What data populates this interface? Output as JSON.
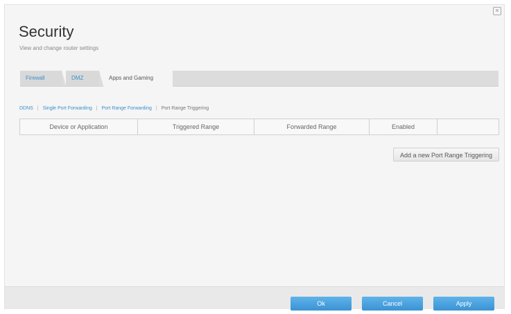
{
  "header": {
    "title": "Security",
    "subtitle": "View and change router settings"
  },
  "tabs": [
    {
      "label": "Firewall",
      "active": false
    },
    {
      "label": "DMZ",
      "active": false
    },
    {
      "label": "Apps and Gaming",
      "active": true
    }
  ],
  "subnav": {
    "items": [
      {
        "label": "DDNS",
        "current": false
      },
      {
        "label": "Single Port Forwarding",
        "current": false
      },
      {
        "label": "Port Range Forwarding",
        "current": false
      },
      {
        "label": "Port Range Triggering",
        "current": true
      }
    ]
  },
  "table": {
    "columns": [
      "Device or Application",
      "Triggered Range",
      "Forwarded Range",
      "Enabled",
      ""
    ]
  },
  "actions": {
    "add_label": "Add a new Port Range Triggering"
  },
  "footer": {
    "ok_label": "Ok",
    "cancel_label": "Cancel",
    "apply_label": "Apply"
  },
  "colors": {
    "accent": "#3a8fc9",
    "button": "#4aa3e0",
    "background": "#f5f5f5"
  }
}
